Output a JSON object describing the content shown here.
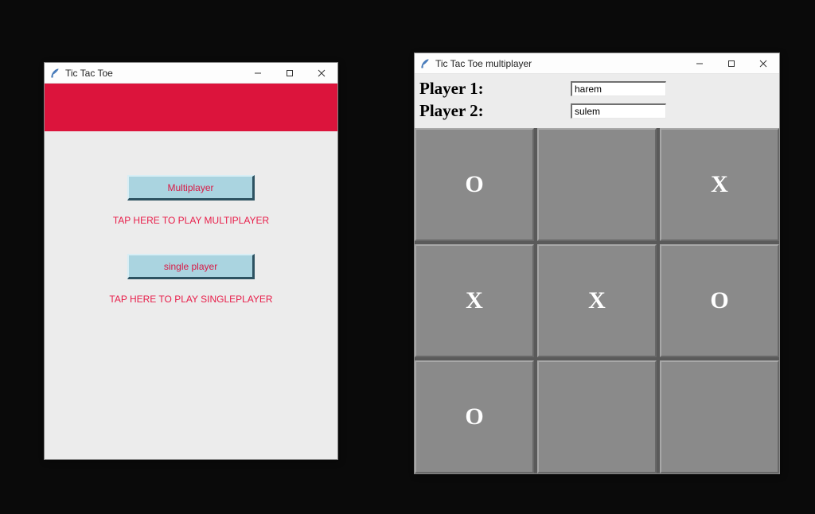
{
  "window1": {
    "title": "Tic Tac Toe",
    "buttons": {
      "multiplayer_label": "Multiplayer",
      "multiplayer_caption": "TAP HERE TO PLAY MULTIPLAYER",
      "single_label": "single player",
      "single_caption": "TAP HERE TO PLAY SINGLEPLAYER"
    }
  },
  "window2": {
    "title": "Tic Tac Toe multiplayer",
    "player1_label": "Player 1:",
    "player2_label": "Player 2:",
    "player1_value": "harem",
    "player2_value": "sulem",
    "board": {
      "c0": "O",
      "c1": "",
      "c2": "X",
      "c3": "X",
      "c4": "X",
      "c5": "O",
      "c6": "O",
      "c7": "",
      "c8": ""
    }
  }
}
